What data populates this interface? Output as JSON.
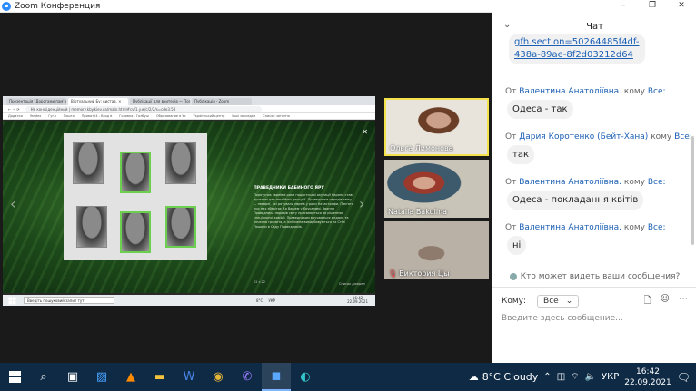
{
  "window": {
    "title": "Zoom Конференция",
    "controls": [
      "–",
      "❐",
      "✕"
    ]
  },
  "shared_screen": {
    "tabs": [
      "Презентація \"Дорогами пам'яті\"",
      "Віртуальний Бу: вистав. ×",
      "Публікації для вчителів — Погру",
      "Публікація - Zoom"
    ],
    "url": "Не конфіденційний | memory.kby.kiev.ua/main.html#cv/1.y.w/c/2/2/s=cde3.58",
    "bookmarks": [
      "Додатки",
      "Yandex",
      "Гугл",
      "Пошта",
      "Приват24 - Вход в",
      "Головна - Галбуш",
      "Образование в Ук",
      "Український центр",
      "Інші закладки",
      "Список читання"
    ],
    "slide": {
      "title": "ПРАВЕДНИКИ БАБИНОГО ЯРУ",
      "text": "Порятунок євреїв в роки нацистської окупації Європи став пунктом для постійної дискусії. Праведники народів світу — неєвреї, які рятували євреїв у роки Катастрофи. Пам'ять про них зберігає Яд Вашем у Єрусалимі. Звання Праведника народів світу присвоюється за рішенням спеціальної комісії. Праведникам вручаються медаль та почесна грамота, а їхні імена викарбовуються на Стіні Пошани в Саду Праведників.",
      "counter": "22 з 22",
      "source": "Список джерел",
      "close": "✕",
      "prev": "‹",
      "next": "›"
    },
    "taskbar": {
      "search": "Введіть пошуковий запит тут",
      "temp": "8°C",
      "lang": "УКР",
      "time": "16:42",
      "date": "22.09.2021"
    }
  },
  "participants": [
    {
      "name": "Ольга Лимонова",
      "active_speaker": true
    },
    {
      "name": "Natalia Bakulina",
      "active_speaker": false
    },
    {
      "name": "Виктория Цы",
      "active_speaker": false,
      "muted": true
    }
  ],
  "chat": {
    "title": "Чат",
    "link_text": "gfh.section=50264485f4df-438a-89ae-8f2d03212d64",
    "messages": [
      {
        "from_prefix": "От",
        "from": "Валентина Анатоліївна.",
        "to_word": "кому",
        "to": "Все:",
        "text": "Одеса - так"
      },
      {
        "from_prefix": "От",
        "from": "Дария Коротенко (Бейт-Хана)",
        "to_word": "кому",
        "to": "Все:",
        "text": "так"
      },
      {
        "from_prefix": "От",
        "from": "Валентина Анатоліївна.",
        "to_word": "кому",
        "to": "Все:",
        "text": "Одеса - покладання квітів"
      },
      {
        "from_prefix": "От",
        "from": "Валентина Анатоліївна.",
        "to_word": "кому",
        "to": "Все:",
        "text": "ні"
      }
    ],
    "visibility_text": "Кто может видеть ваши сообщения?",
    "to_label": "Кому:",
    "to_value": "Все",
    "input_placeholder": "Введите здесь сообщение..."
  },
  "taskbar": {
    "weather": "8°C  Cloudy",
    "lang": "УКР",
    "time": "16:42",
    "date": "22.09.2021"
  }
}
